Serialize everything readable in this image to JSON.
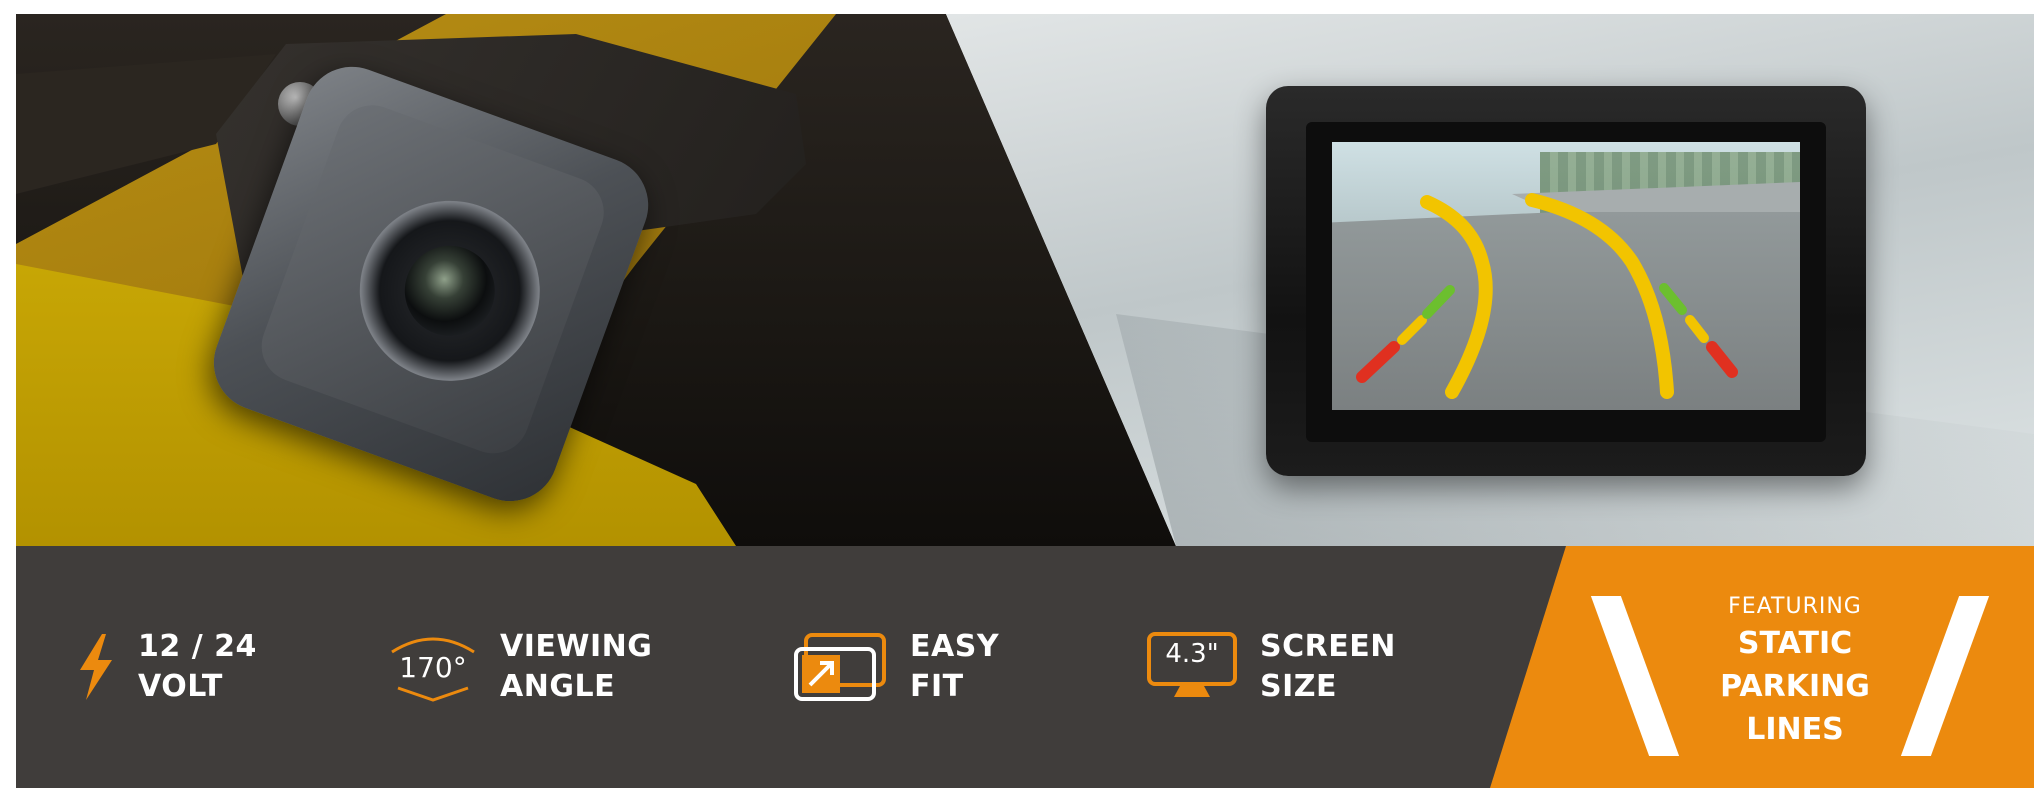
{
  "hero": {
    "left_image": "rear-view-camera",
    "right_image": "monitor-with-parking-lines"
  },
  "features": [
    {
      "icon": "lightning-icon",
      "line1": "12 / 24",
      "line2": "VOLT"
    },
    {
      "icon": "viewing-angle-icon",
      "icon_text": "170°",
      "line1": "VIEWING",
      "line2": "ANGLE"
    },
    {
      "icon": "easy-fit-icon",
      "line1": "EASY",
      "line2": "FIT"
    },
    {
      "icon": "screen-size-icon",
      "icon_text": "4.3\"",
      "line1": "SCREEN",
      "line2": "SIZE"
    }
  ],
  "badge": {
    "pre": "FEATURING",
    "lines": [
      "STATIC",
      "PARKING",
      "LINES"
    ]
  },
  "colors": {
    "accent": "#ec8a0e",
    "bar": "#403d3b",
    "text": "#ffffff"
  }
}
